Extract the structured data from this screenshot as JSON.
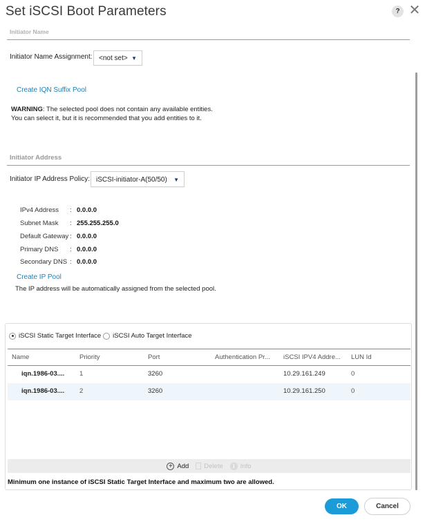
{
  "dialog": {
    "title": "Set iSCSI Boot Parameters",
    "help_label": "?",
    "close_label": "✕"
  },
  "initiator_name": {
    "section_title": "Initiator Name",
    "assignment_label": "Initiator Name Assignment:",
    "assignment_value": "<not set>",
    "create_pool_link": "Create IQN Suffix Pool",
    "warning_prefix": "WARNING",
    "warning_line1": ": The selected pool does not contain any available entities.",
    "warning_line2": "You can select it, but it is recommended that you add entities to it."
  },
  "initiator_address": {
    "section_title": "Initiator Address",
    "policy_label": "Initiator IP Address Policy:",
    "policy_value": "iSCSI-initiator-A(50/50)",
    "fields": [
      {
        "label": "IPv4 Address",
        "value": "0.0.0.0"
      },
      {
        "label": "Subnet Mask",
        "value": "255.255.255.0"
      },
      {
        "label": "Default Gateway",
        "value": "0.0.0.0"
      },
      {
        "label": "Primary DNS",
        "value": "0.0.0.0"
      },
      {
        "label": "Secondary DNS",
        "value": "0.0.0.0"
      }
    ],
    "separator": ":",
    "create_ip_pool_link": "Create IP Pool",
    "note": "The IP address will be automatically assigned from the selected pool."
  },
  "target_interface": {
    "options": [
      {
        "label": "iSCSI Static Target Interface",
        "selected": true
      },
      {
        "label": "iSCSI Auto Target Interface",
        "selected": false
      }
    ],
    "columns": [
      "Name",
      "Priority",
      "Port",
      "Authentication Pr...",
      "iSCSI IPV4 Addre...",
      "LUN Id"
    ],
    "rows": [
      {
        "name": "iqn.1986-03....",
        "priority": "1",
        "port": "3260",
        "auth": "",
        "ip": "10.29.161.249",
        "lun": "0"
      },
      {
        "name": "iqn.1986-03....",
        "priority": "2",
        "port": "3260",
        "auth": "",
        "ip": "10.29.161.250",
        "lun": "0"
      }
    ],
    "toolbar": {
      "add": "Add",
      "delete": "Delete",
      "info": "Info"
    },
    "footer_note": "Minimum one instance of iSCSI Static Target Interface and maximum two are allowed."
  },
  "buttons": {
    "ok": "OK",
    "cancel": "Cancel"
  },
  "colors": {
    "primary_button": "#1b9bd7",
    "link": "#1f7fb3",
    "row_highlight": "#eef6fb"
  }
}
